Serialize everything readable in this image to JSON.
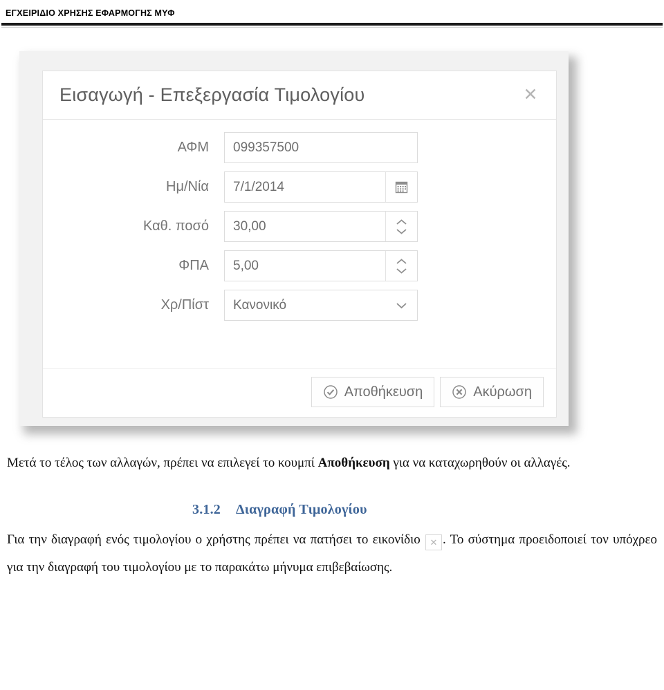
{
  "document": {
    "header_title": "ΕΓΧΕΙΡΙΔΙΟ ΧΡΗΣΗΣ ΕΦΑΡΜΟΓΗΣ ΜΥΦ"
  },
  "dialog": {
    "title": "Εισαγωγή - Επεξεργασία Τιμολογίου",
    "close_label": "✕",
    "fields": [
      {
        "label": "ΑΦΜ",
        "value": "099357500",
        "addon": "none"
      },
      {
        "label": "Ημ/Νία",
        "value": "7/1/2014",
        "addon": "calendar-icon"
      },
      {
        "label": "Καθ. ποσό",
        "value": "30,00",
        "addon": "spinner"
      },
      {
        "label": "ΦΠΑ",
        "value": "5,00",
        "addon": "spinner"
      },
      {
        "label": "Χρ/Πίστ",
        "value": "Κανονικό",
        "addon": "chevron-down-icon"
      }
    ],
    "buttons": {
      "save": "Αποθήκευση",
      "cancel": "Ακύρωση"
    }
  },
  "content": {
    "paragraph1_before_bold": "Μετά το τέλος των αλλαγών, πρέπει να επιλεγεί το κουμπί ",
    "paragraph1_bold": "Αποθήκευση",
    "paragraph1_after_bold": " για να καταχωρηθούν οι αλλαγές.",
    "section_number": "3.1.2",
    "section_title": "Διαγραφή Τιμολογίου",
    "paragraph2_before_icon": "Για την διαγραφή ενός τιμολογίου ο χρήστης πρέπει να πατήσει το εικονίδιο ",
    "inline_icon_glyph": "✕",
    "paragraph2_after_icon": ". Το σύστημα προειδοποιεί τον υπόχρεο για την διαγραφή του τιμολογίου με το παρακάτω μήνυμα επιβεβαίωσης."
  },
  "colors": {
    "heading_blue": "#3e6598",
    "rule_dark": "#1b1b1b",
    "dialog_title_gray": "#5e5e5e",
    "field_border": "#dcdcdc"
  }
}
